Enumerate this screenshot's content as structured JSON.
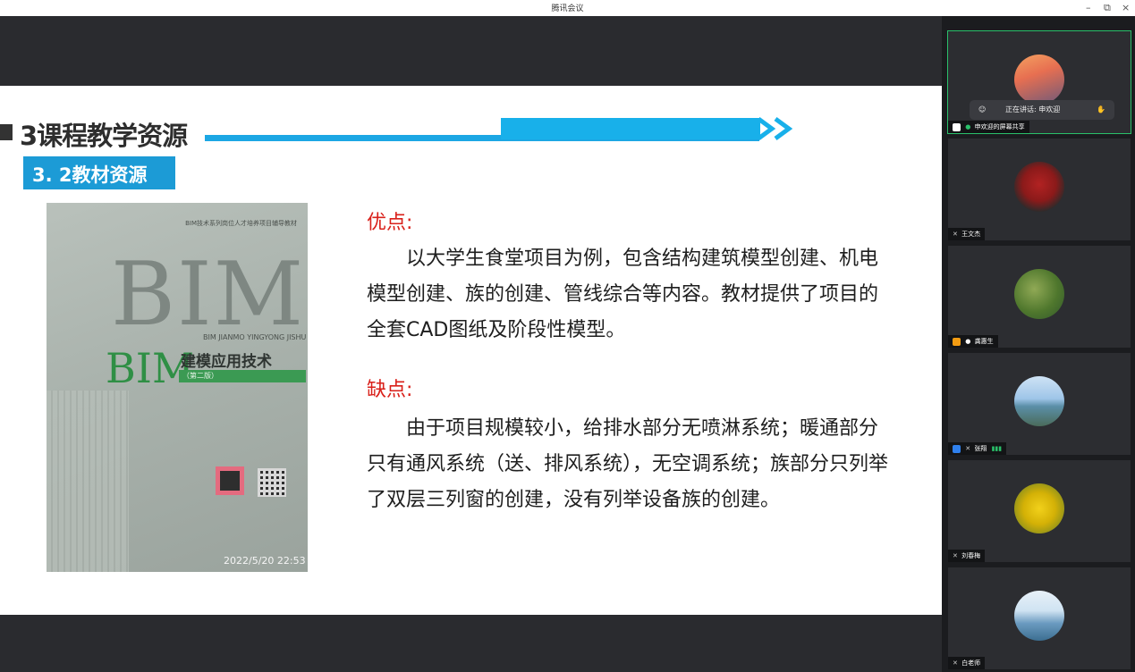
{
  "window": {
    "title": "腾讯会议",
    "minimize_label": "–",
    "restore_label": "⧉",
    "close_label": "×"
  },
  "slide": {
    "section_title": "3课程教学资源",
    "subsection_title": "3. 2教材资源",
    "book": {
      "series": "BIM技术系列岗位人才培养项目辅导教材",
      "bim_large": "BIM",
      "pinyin": "BIM JIANMO YINGYONG JISHU",
      "bim_green": "BIM",
      "title": "建模应用技术",
      "edition": "（第二版）",
      "photo_timestamp": "2022/5/20 22:53"
    },
    "pros_heading": "优点:",
    "pros_text": "以大学生食堂项目为例，包含结构建筑模型创建、机电模型创建、族的创建、管线综合等内容。教材提供了项目的全套CAD图纸及阶段性模型。",
    "cons_heading": "缺点:",
    "cons_text": "由于项目规模较小，给排水部分无喷淋系统；暖通部分只有通风系统（送、排风系统），无空调系统；族部分只列举了双层三列窗的创建，没有列举设备族的创建。"
  },
  "participants": [
    {
      "name": "申欢迎的屏幕共享",
      "speaking_label": "正在讲话: 申欢迎",
      "active": true,
      "avatar_colors": [
        "#f4a261",
        "#6d597a"
      ]
    },
    {
      "name": "王文杰",
      "active": false,
      "avatar_colors": [
        "#8b1a1a",
        "#2b2b2b"
      ]
    },
    {
      "name": "龚惠生",
      "active": false,
      "avatar_colors": [
        "#4f772d",
        "#90a955"
      ]
    },
    {
      "name": "张翔",
      "active": false,
      "avatar_colors": [
        "#9ec5e8",
        "#4a6b5a"
      ]
    },
    {
      "name": "刘春梅",
      "active": false,
      "avatar_colors": [
        "#f2d11b",
        "#5d7a2a"
      ]
    },
    {
      "name": "白老师",
      "active": false,
      "avatar_colors": [
        "#cfe3f2",
        "#3c6e91"
      ]
    }
  ],
  "colors": {
    "accent_blue": "#1ca7e4",
    "red_heading": "#d9201a",
    "active_green": "#2ac06a"
  }
}
